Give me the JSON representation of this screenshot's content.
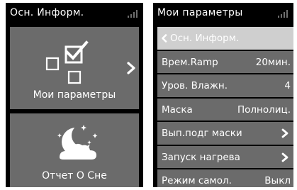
{
  "left_screen": {
    "title": "Осн. Информ.",
    "tiles": [
      {
        "label": "Мои параметры",
        "icon": "checkbox-squares-icon",
        "has_chevron": true
      },
      {
        "label": "Отчет О Сне",
        "icon": "moon-cloud-stars-icon"
      }
    ]
  },
  "right_screen": {
    "title": "Мои параметры",
    "back_label": "Осн. Информ.",
    "items": [
      {
        "label": "Врем.Ramp",
        "value": "20мин."
      },
      {
        "label": "Уров. Влажн.",
        "value": "4"
      },
      {
        "label": "Маска",
        "value": "Полнолиц."
      },
      {
        "label": "Вып.подг маски",
        "value": "",
        "chevron": true
      },
      {
        "label": "Запуск нагрева",
        "value": "",
        "chevron": true
      },
      {
        "label": "Режим самол.",
        "value": "Выкл"
      }
    ]
  },
  "colors": {
    "screen_bg": "#000000",
    "tile_bg": "#6b6b6b",
    "back_row_bg": "#cfcfcf",
    "text": "#ffffff"
  }
}
